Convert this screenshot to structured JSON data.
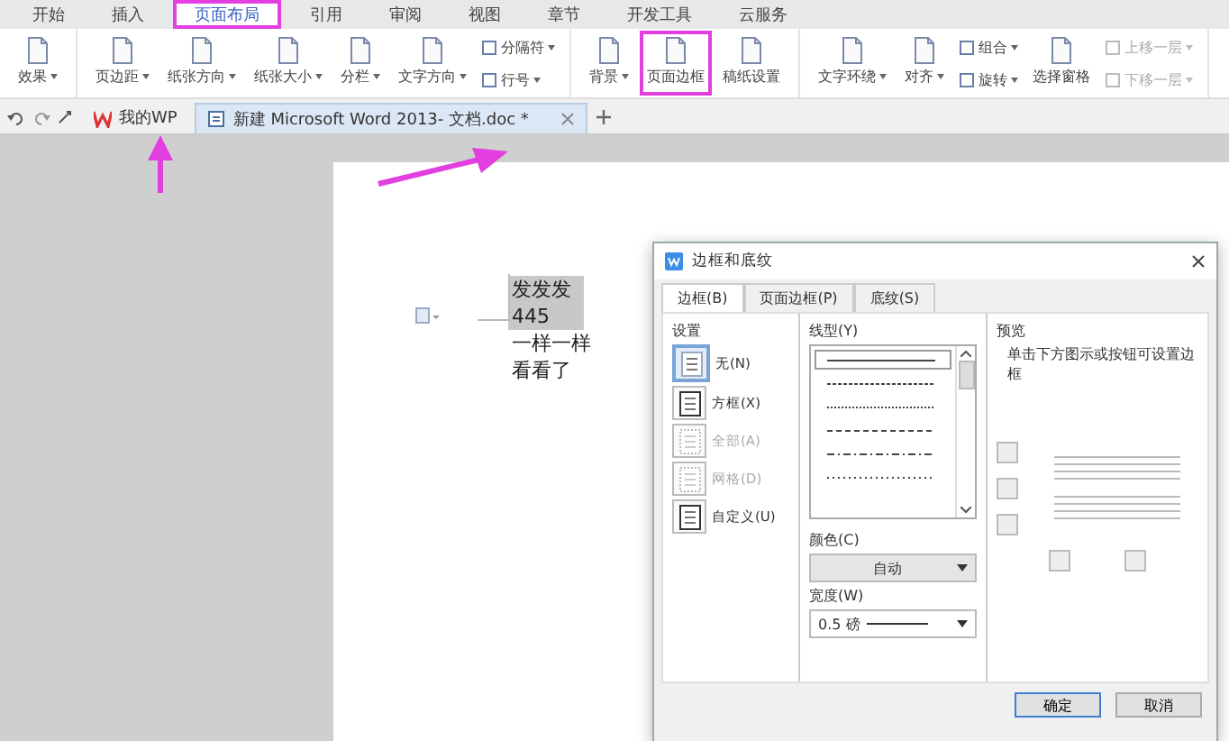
{
  "menu_tabs": [
    {
      "label": "开始",
      "selected": false,
      "highlighted": false
    },
    {
      "label": "插入",
      "selected": false,
      "highlighted": false
    },
    {
      "label": "页面布局",
      "selected": true,
      "highlighted": true
    },
    {
      "label": "引用",
      "selected": false,
      "highlighted": false
    },
    {
      "label": "审阅",
      "selected": false,
      "highlighted": false
    },
    {
      "label": "视图",
      "selected": false,
      "highlighted": false
    },
    {
      "label": "章节",
      "selected": false,
      "highlighted": false
    },
    {
      "label": "开发工具",
      "selected": false,
      "highlighted": false
    },
    {
      "label": "云服务",
      "selected": false,
      "highlighted": false
    }
  ],
  "ribbon": {
    "groups": [
      {
        "items": [
          {
            "kind": "large",
            "label": "效果",
            "dropdown": true,
            "highlighted": false,
            "disabled": false
          }
        ]
      },
      {
        "items": [
          {
            "kind": "large",
            "label": "页边距",
            "dropdown": true,
            "highlighted": false,
            "disabled": false
          },
          {
            "kind": "large",
            "label": "纸张方向",
            "dropdown": true,
            "highlighted": false,
            "disabled": false
          },
          {
            "kind": "large",
            "label": "纸张大小",
            "dropdown": true,
            "highlighted": false,
            "disabled": false
          },
          {
            "kind": "large",
            "label": "分栏",
            "dropdown": true,
            "highlighted": false,
            "disabled": false
          },
          {
            "kind": "large",
            "label": "文字方向",
            "dropdown": true,
            "highlighted": false,
            "disabled": false
          },
          {
            "kind": "stack",
            "items": [
              {
                "label": "分隔符",
                "dropdown": true,
                "disabled": false
              },
              {
                "label": "行号",
                "dropdown": true,
                "disabled": false
              }
            ]
          }
        ]
      },
      {
        "items": [
          {
            "kind": "large",
            "label": "背景",
            "dropdown": true,
            "highlighted": false,
            "disabled": false
          },
          {
            "kind": "large",
            "label": "页面边框",
            "dropdown": false,
            "highlighted": true,
            "disabled": false
          },
          {
            "kind": "large",
            "label": "稿纸设置",
            "dropdown": false,
            "highlighted": false,
            "disabled": false
          }
        ]
      },
      {
        "items": [
          {
            "kind": "large",
            "label": "文字环绕",
            "dropdown": true,
            "highlighted": false,
            "disabled": false
          },
          {
            "kind": "large",
            "label": "对齐",
            "dropdown": true,
            "highlighted": false,
            "disabled": false
          },
          {
            "kind": "stack",
            "items": [
              {
                "label": "组合",
                "dropdown": true,
                "disabled": false
              },
              {
                "label": "旋转",
                "dropdown": true,
                "disabled": false
              }
            ]
          },
          {
            "kind": "large",
            "label": "选择窗格",
            "dropdown": false,
            "highlighted": false,
            "disabled": false
          },
          {
            "kind": "stack",
            "items": [
              {
                "label": "上移一层",
                "dropdown": true,
                "disabled": true
              },
              {
                "label": "下移一层",
                "dropdown": true,
                "disabled": true
              }
            ]
          }
        ]
      }
    ]
  },
  "doc_tabs": [
    {
      "label": "我的WP",
      "selected": false
    },
    {
      "label": "新建 Microsoft Word 2013-  文档.doc *",
      "selected": true
    }
  ],
  "document": {
    "lines": [
      {
        "text": "发发发",
        "highlighted": true
      },
      {
        "text": "445",
        "highlighted": true
      },
      {
        "text": "一样一样",
        "highlighted": false
      },
      {
        "text": "看看了",
        "highlighted": false
      }
    ]
  },
  "dialog": {
    "title": "边框和底纹",
    "tabs": [
      {
        "label": "边框(B)",
        "selected": true
      },
      {
        "label": "页面边框(P)",
        "selected": false
      },
      {
        "label": "底纹(S)",
        "selected": false
      }
    ],
    "setting_label": "设置",
    "settings": [
      {
        "label": "无(N)",
        "selected": true,
        "disabled": false
      },
      {
        "label": "方框(X)",
        "selected": false,
        "disabled": false
      },
      {
        "label": "全部(A)",
        "selected": false,
        "disabled": true
      },
      {
        "label": "网格(D)",
        "selected": false,
        "disabled": true
      },
      {
        "label": "自定义(U)",
        "selected": false,
        "disabled": false
      }
    ],
    "line_style_label": "线型(Y)",
    "line_styles": [
      {
        "kind": "solid",
        "selected": true
      },
      {
        "kind": "dotted",
        "selected": false
      },
      {
        "kind": "dense",
        "selected": false
      },
      {
        "kind": "dashed",
        "selected": false
      },
      {
        "kind": "dashdot",
        "selected": false
      },
      {
        "kind": "dotdash",
        "selected": false
      }
    ],
    "color_label": "颜色(C)",
    "color_value": "自动",
    "width_label": "宽度(W)",
    "width_value": "0.5 磅",
    "preview_label": "预览",
    "preview_hint": "单击下方图示或按钮可设置边框",
    "buttons": [
      "确定",
      "取消"
    ]
  }
}
